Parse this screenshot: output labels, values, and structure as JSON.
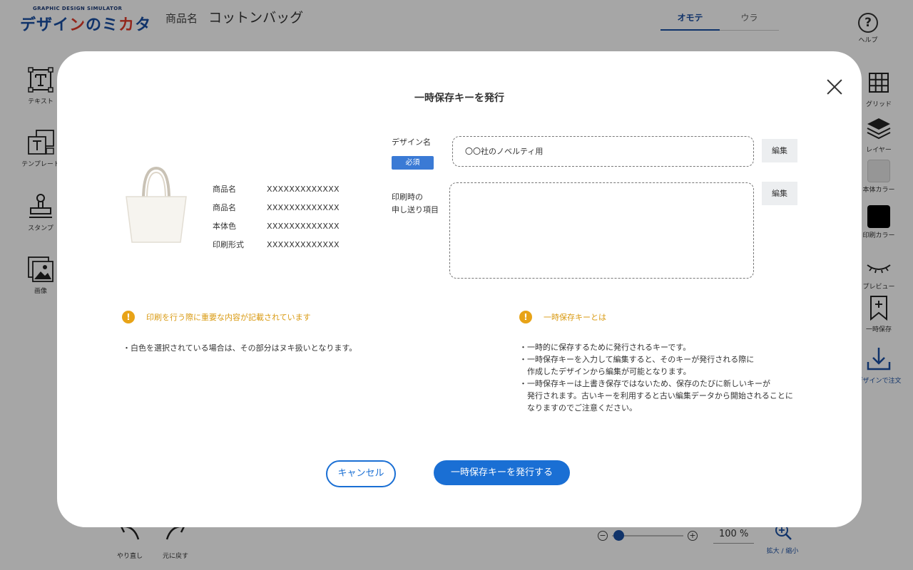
{
  "app": {
    "logo_sub": "GRAPHIC DESIGN SIMULATOR",
    "logo_main_a": "デザイ",
    "logo_main_b": "ン",
    "logo_main_c": "のミ",
    "logo_main_d": "カ",
    "logo_main_e": "タ",
    "product_label": "商品名",
    "product_name": "コットンバッグ",
    "view_tabs": [
      "オモテ",
      "ウラ"
    ],
    "left_tools": [
      "テキスト",
      "テンプレート",
      "スタンプ",
      "画像"
    ],
    "help_label": "ヘルプ",
    "right_tools": [
      "グリッド",
      "レイヤー",
      "本体カラー",
      "印刷カラー",
      "プレビュー",
      "一時保存",
      "デザインで注文"
    ],
    "undo_label": "やり直し",
    "redo_label": "元に戻す",
    "zoom_minus": "−",
    "zoom_plus": "+",
    "zoom_level": "100 %",
    "zoom_fraction": 0.02,
    "zoom_tool_label": "拡大 / 縮小",
    "colors": {
      "brand": "#1a4fa3",
      "logo_accent": "#e23b2a",
      "body_color": "#e6e6e6",
      "print_color": "#000000"
    }
  },
  "modal": {
    "title": "一時保存キーを発行",
    "close_icon": "close-icon",
    "product_image": "tote-bag-image",
    "info": [
      {
        "label": "商品名",
        "value": "XXXXXXXXXXXXX"
      },
      {
        "label": "商品名",
        "value": "XXXXXXXXXXXXX"
      },
      {
        "label": "本体色",
        "value": "XXXXXXXXXXXXX"
      },
      {
        "label": "印刷形式",
        "value": "XXXXXXXXXXXXX"
      }
    ],
    "design_name_label": "デザイン名",
    "required_badge": "必須",
    "design_name_value": "〇〇社のノベルティ用",
    "notes_label_line1": "印刷時の",
    "notes_label_line2": "申し送り項目",
    "notes_value": "",
    "edit_label": "編集",
    "notice_left": {
      "title": "印刷を行う際に重要な内容が記載されています",
      "lines": [
        "・白色を選択されている場合は、その部分はヌキ扱いとなります。"
      ]
    },
    "notice_right": {
      "title": "一時保存キーとは",
      "lines": [
        "・一時的に保存するために発行されるキーです。",
        "・一時保存キーを入力して編集すると、そのキーが発行される際に",
        "　作成したデザインから編集が可能となります。",
        "・一時保存キーは上書き保存ではないため、保存のたびに新しいキーが",
        "　発行されます。古いキーを利用すると古い編集データから開始されることに",
        "　なりますのでご注意ください。"
      ]
    },
    "cancel_label": "キャンセル",
    "issue_label": "一時保存キーを発行する",
    "colors": {
      "primary": "#1a6fd4",
      "required_bg": "#3a7ad5",
      "warning": "#e8a317"
    }
  }
}
